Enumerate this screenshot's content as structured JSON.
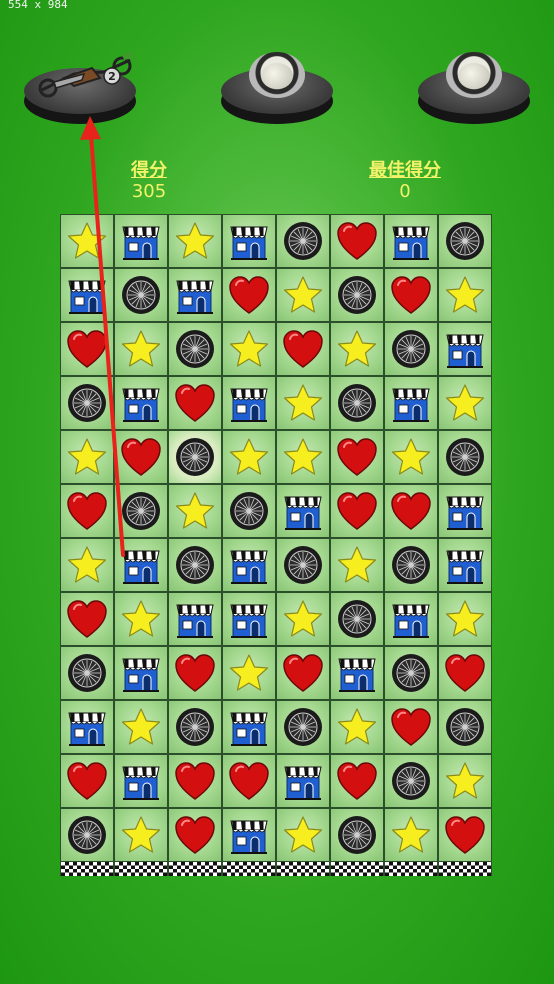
{
  "dimension_label": "554 x 984",
  "score": {
    "label": "得分",
    "value": "305"
  },
  "best_score": {
    "label": "最佳得分",
    "value": "0"
  },
  "pods": [
    {
      "name": "pod-1",
      "state": "motorcycle-2",
      "number": "2"
    },
    {
      "name": "pod-2",
      "state": "empty"
    },
    {
      "name": "pod-3",
      "state": "empty"
    }
  ],
  "board": {
    "columns": 8,
    "rows": [
      [
        "star",
        "shop",
        "star",
        "shop",
        "wheel",
        "heart",
        "shop",
        "wheel"
      ],
      [
        "shop",
        "wheel",
        "shop",
        "heart",
        "star",
        "wheel",
        "heart",
        "star"
      ],
      [
        "heart",
        "star",
        "wheel",
        "star",
        "heart",
        "star",
        "wheel",
        "shop"
      ],
      [
        "wheel",
        "shop",
        "heart",
        "shop",
        "star",
        "wheel",
        "shop",
        "star"
      ],
      [
        "star",
        "heart",
        "wheel",
        "star",
        "star",
        "heart",
        "star",
        "wheel"
      ],
      [
        "heart",
        "wheel",
        "star",
        "wheel",
        "shop",
        "heart",
        "heart",
        "shop"
      ],
      [
        "star",
        "shop",
        "wheel",
        "shop",
        "wheel",
        "star",
        "wheel",
        "shop"
      ],
      [
        "heart",
        "star",
        "shop",
        "shop",
        "star",
        "wheel",
        "shop",
        "star"
      ],
      [
        "wheel",
        "shop",
        "heart",
        "star",
        "heart",
        "shop",
        "wheel",
        "heart"
      ],
      [
        "shop",
        "star",
        "wheel",
        "shop",
        "wheel",
        "star",
        "heart",
        "wheel"
      ],
      [
        "heart",
        "shop",
        "heart",
        "heart",
        "shop",
        "heart",
        "wheel",
        "star"
      ],
      [
        "wheel",
        "star",
        "heart",
        "shop",
        "star",
        "wheel",
        "star",
        "heart"
      ]
    ],
    "highlighted": {
      "row": 4,
      "col": 2
    }
  },
  "colors": {
    "background": "#2fa61f",
    "score_text": "#f3f36a",
    "arrow": "#e8231b",
    "heart": "#d40f0f",
    "star": "#f6ee1f",
    "shop": "#1f5fd1"
  }
}
